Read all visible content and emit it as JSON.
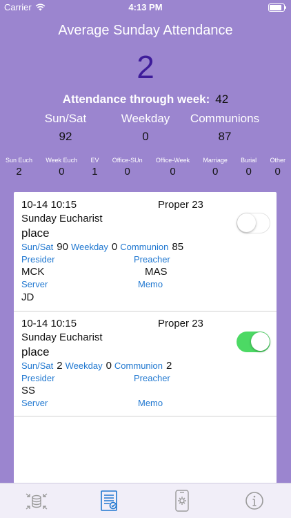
{
  "status_bar": {
    "carrier": "Carrier",
    "time": "4:13 PM",
    "battery_level": 0.95
  },
  "header": {
    "title": "Average Sunday Attendance",
    "average": "2"
  },
  "week": {
    "label": "Attendance through week:",
    "value": "42"
  },
  "summary": {
    "labels": [
      "Sun/Sat",
      "Weekday",
      "Communions"
    ],
    "values": [
      "92",
      "0",
      "87"
    ]
  },
  "categories": [
    {
      "label": "Sun Euch",
      "value": "2"
    },
    {
      "label": "Week Euch",
      "value": "0"
    },
    {
      "label": "EV",
      "value": "1"
    },
    {
      "label": "Office-SUn",
      "value": "0"
    },
    {
      "label": "Office-Week",
      "value": "0"
    },
    {
      "label": "Marriage",
      "value": "0"
    },
    {
      "label": "Burial",
      "value": "0"
    },
    {
      "label": "Other",
      "value": "0"
    }
  ],
  "field_labels": {
    "sunsat": "Sun/Sat",
    "weekday": "Weekday",
    "communion": "Communion",
    "presider": "Presider",
    "preacher": "Preacher",
    "server": "Server",
    "memo": "Memo"
  },
  "services": [
    {
      "datetime": "10-14 10:15",
      "proper": "Proper 23",
      "service": "Sunday Eucharist",
      "place": "place",
      "sunsat": "90",
      "weekday": "0",
      "communion": "85",
      "presider": "MCK",
      "preacher": "MAS",
      "server": "JD",
      "memo": "",
      "toggle_on": false
    },
    {
      "datetime": "10-14 10:15",
      "proper": "Proper 23",
      "service": "Sunday Eucharist",
      "place": "place",
      "sunsat": "2",
      "weekday": "0",
      "communion": "2",
      "presider": "SS",
      "preacher": "",
      "server": "",
      "memo": "",
      "toggle_on": true
    }
  ],
  "tabbar": {
    "icons": [
      "database-sync-icon",
      "checklist-document-icon",
      "phone-settings-icon",
      "info-icon"
    ],
    "active": 1,
    "active_color": "#1f77d0",
    "inactive_color": "#9a9a9a"
  },
  "colors": {
    "background": "#9b85cf",
    "average": "#3e1c9a",
    "toggle_on": "#4cd964",
    "label_blue": "#1f77d0"
  }
}
